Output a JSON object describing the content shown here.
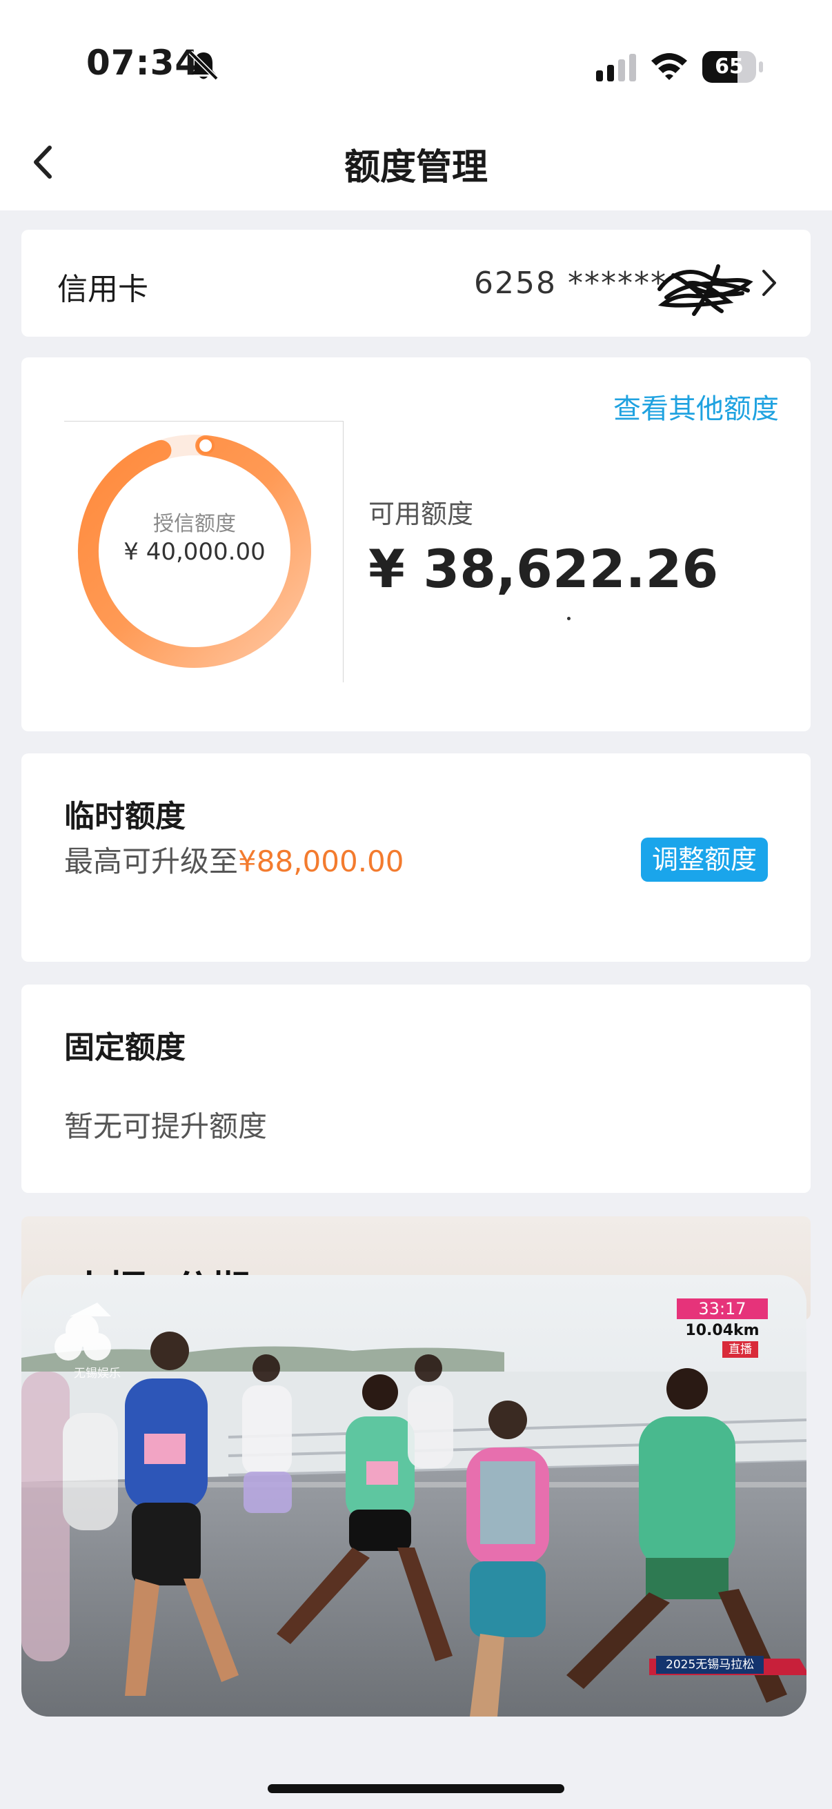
{
  "status": {
    "time": "07:34",
    "battery": "65",
    "battery_level": 0.65,
    "icons": [
      "bell-slash-icon",
      "cellular-signal-icon",
      "wifi-icon",
      "battery-icon"
    ]
  },
  "nav": {
    "title": "额度管理",
    "back_icon": "chevron-left-icon"
  },
  "card_info": {
    "label": "信用卡",
    "number": "6258 ******",
    "chevron_icon": "chevron-right-icon"
  },
  "limit": {
    "other_link": "查看其他额度",
    "credit_label": "授信额度",
    "credit_value": "¥ 40,000.00",
    "available_label": "可用额度",
    "available_value": "¥ 38,622.26",
    "available_ratio": 0.9656
  },
  "temp": {
    "title": "临时额度",
    "prefix": "最高可升级至",
    "amount": "¥88,000.00",
    "button": "调整额度"
  },
  "fixed": {
    "title": "固定额度",
    "desc": "暂无可提升额度"
  },
  "promo": {
    "title": "小招e分期"
  },
  "video": {
    "channel": "无锡娱乐",
    "timer": "33:17",
    "distance": "10.04km",
    "live": "直播",
    "event": "2025无锡马拉松"
  },
  "colors": {
    "accent_blue": "#1aa5eb",
    "accent_orange": "#f37b2e",
    "background": "#eff0f4"
  }
}
